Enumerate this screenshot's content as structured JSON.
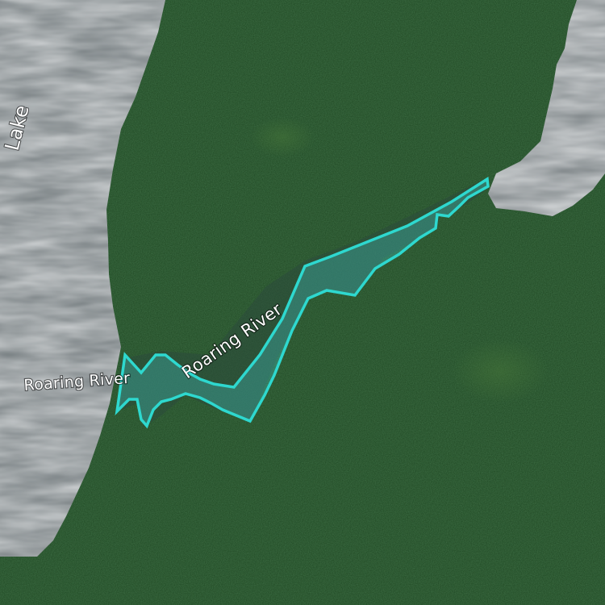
{
  "map": {
    "labels": {
      "lake_partial": "Lake",
      "river_west": "Roaring River",
      "river_main": "Roaring River"
    },
    "colors": {
      "forest": "#1f4a22",
      "forest_dark": "#153517",
      "water": "#7f8688",
      "water_glare": "#c9cdce",
      "highlight": "#2fd6cc",
      "highlight_fill": "#3fc2c6"
    }
  }
}
